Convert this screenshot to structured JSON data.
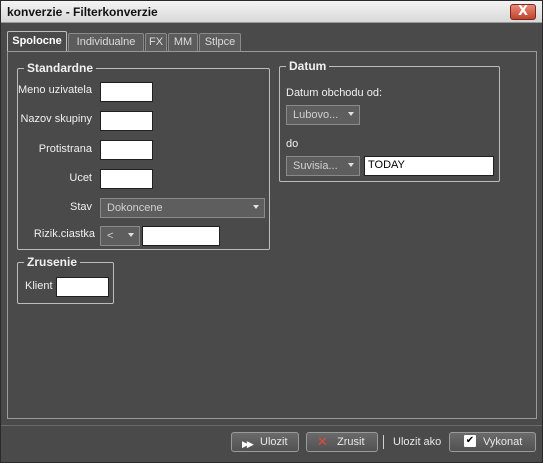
{
  "window": {
    "title": "konverzie - Filterkonverzie",
    "close_label": "X"
  },
  "tabs": [
    "Spolocne",
    "Individualne",
    "FX",
    "MM",
    "Stlpce"
  ],
  "standardne": {
    "title": "Standardne",
    "meno_label": "Meno uzivatela",
    "nazov_label": "Nazov skupiny",
    "protistrana_label": "Protistrana",
    "ucet_label": "Ucet",
    "stav_label": "Stav",
    "stav_value": "Dokoncene",
    "rizik_label": "Rizik.ciastka",
    "rizik_op": "<"
  },
  "zrusenie": {
    "title": "Zrusenie",
    "klient_label": "Klient"
  },
  "datum": {
    "title": "Datum",
    "od_label": "Datum obchodu od:",
    "od_combo": "Lubovo...",
    "do_label": "do",
    "do_combo": "Suvisia...",
    "do_value": "TODAY"
  },
  "footer": {
    "ulozit": "Ulozit",
    "zrusit": "Zrusit",
    "ulozit_ako": "Ulozit ako",
    "vykonat": "Vykonat"
  }
}
